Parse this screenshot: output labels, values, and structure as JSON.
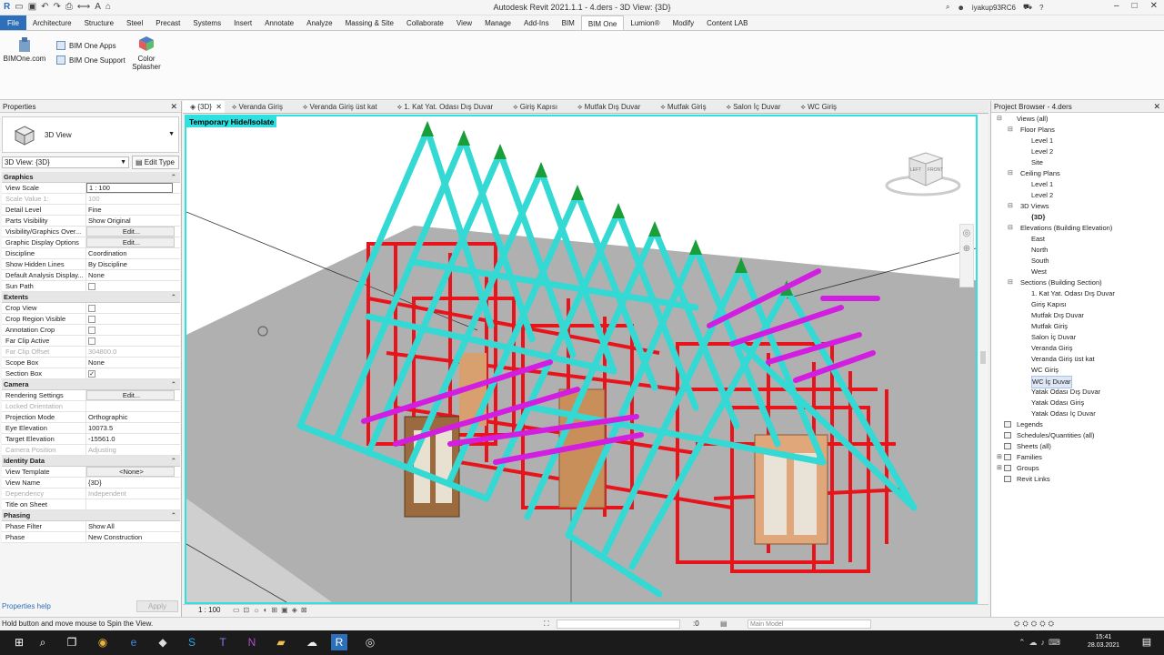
{
  "titlebar": {
    "title": "Autodesk Revit 2021.1.1 - 4.ders - 3D View: {3D}",
    "user": "iyakup93RC6"
  },
  "menu": {
    "tabs": [
      "File",
      "Architecture",
      "Structure",
      "Steel",
      "Precast",
      "Systems",
      "Insert",
      "Annotate",
      "Analyze",
      "Massing & Site",
      "Collaborate",
      "View",
      "Manage",
      "Add-Ins",
      "BIM",
      "BIM One",
      "Lumion®",
      "Modify",
      "Content LAB"
    ]
  },
  "ribbon": {
    "bimone_com": "BIMOne.com",
    "bimone_apps": "BIM One Apps",
    "bimone_support": "BIM One Support",
    "color_splasher": "Color Splasher"
  },
  "properties": {
    "title": "Properties",
    "type_name": "3D View",
    "view_selector": "3D View: {3D}",
    "edit_type": "Edit Type",
    "groups": [
      {
        "name": "Graphics",
        "rows": [
          {
            "k": "View Scale",
            "v": "1 : 100",
            "kind": "input"
          },
          {
            "k": "Scale Value    1:",
            "v": "100",
            "kind": "dim"
          },
          {
            "k": "Detail Level",
            "v": "Fine"
          },
          {
            "k": "Parts Visibility",
            "v": "Show Original"
          },
          {
            "k": "Visibility/Graphics Over...",
            "v": "Edit...",
            "kind": "btn"
          },
          {
            "k": "Graphic Display Options",
            "v": "Edit...",
            "kind": "btn"
          },
          {
            "k": "Discipline",
            "v": "Coordination"
          },
          {
            "k": "Show Hidden Lines",
            "v": "By Discipline"
          },
          {
            "k": "Default Analysis Display...",
            "v": "None"
          },
          {
            "k": "Sun Path",
            "v": "",
            "kind": "cb"
          }
        ]
      },
      {
        "name": "Extents",
        "rows": [
          {
            "k": "Crop View",
            "v": "",
            "kind": "cb"
          },
          {
            "k": "Crop Region Visible",
            "v": "",
            "kind": "cb"
          },
          {
            "k": "Annotation Crop",
            "v": "",
            "kind": "cb"
          },
          {
            "k": "Far Clip Active",
            "v": "",
            "kind": "cb"
          },
          {
            "k": "Far Clip Offset",
            "v": "304800.0",
            "kind": "dim"
          },
          {
            "k": "Scope Box",
            "v": "None"
          },
          {
            "k": "Section Box",
            "v": "✓",
            "kind": "cb"
          }
        ]
      },
      {
        "name": "Camera",
        "rows": [
          {
            "k": "Rendering Settings",
            "v": "Edit...",
            "kind": "btn"
          },
          {
            "k": "Locked Orientation",
            "v": "",
            "kind": "dim"
          },
          {
            "k": "Projection Mode",
            "v": "Orthographic"
          },
          {
            "k": "Eye Elevation",
            "v": "10073.5"
          },
          {
            "k": "Target Elevation",
            "v": "-15561.0"
          },
          {
            "k": "Camera Position",
            "v": "Adjusting",
            "kind": "dim"
          }
        ]
      },
      {
        "name": "Identity Data",
        "rows": [
          {
            "k": "View Template",
            "v": "<None>",
            "kind": "btn"
          },
          {
            "k": "View Name",
            "v": "{3D}"
          },
          {
            "k": "Dependency",
            "v": "Independent",
            "kind": "dim"
          },
          {
            "k": "Title on Sheet",
            "v": ""
          }
        ]
      },
      {
        "name": "Phasing",
        "rows": [
          {
            "k": "Phase Filter",
            "v": "Show All"
          },
          {
            "k": "Phase",
            "v": "New Construction"
          }
        ]
      }
    ],
    "help": "Properties help",
    "apply": "Apply"
  },
  "viewtabs": [
    "{3D}",
    "Veranda Giriş",
    "Veranda Giriş üst kat",
    "1. Kat Yat. Odası Dış Duvar",
    "Giriş Kapısı",
    "Mutfak Dış Duvar",
    "Mutfak Giriş",
    "Salon İç Duvar",
    "WC Giriş"
  ],
  "viewport": {
    "banner": "Temporary Hide/Isolate",
    "cube_top": "LEFT",
    "cube_front": "FRONT"
  },
  "viewcontrol": {
    "scale": "1 : 100"
  },
  "browser": {
    "title": "Project Browser - 4.ders",
    "nodes": [
      {
        "t": "Views (all)",
        "lvl": 0,
        "tg": "⊟"
      },
      {
        "t": "Floor Plans",
        "lvl": 1,
        "tg": "⊟"
      },
      {
        "t": "Level 1",
        "lvl": 2
      },
      {
        "t": "Level 2",
        "lvl": 2
      },
      {
        "t": "Site",
        "lvl": 2
      },
      {
        "t": "Ceiling Plans",
        "lvl": 1,
        "tg": "⊟"
      },
      {
        "t": "Level 1",
        "lvl": 2
      },
      {
        "t": "Level 2",
        "lvl": 2
      },
      {
        "t": "3D Views",
        "lvl": 1,
        "tg": "⊟"
      },
      {
        "t": "{3D}",
        "lvl": 2,
        "bold": true
      },
      {
        "t": "Elevations (Building Elevation)",
        "lvl": 1,
        "tg": "⊟"
      },
      {
        "t": "East",
        "lvl": 2
      },
      {
        "t": "North",
        "lvl": 2
      },
      {
        "t": "South",
        "lvl": 2
      },
      {
        "t": "West",
        "lvl": 2
      },
      {
        "t": "Sections (Building Section)",
        "lvl": 1,
        "tg": "⊟"
      },
      {
        "t": "1. Kat Yat. Odası Dış Duvar",
        "lvl": 2
      },
      {
        "t": "Giriş Kapısı",
        "lvl": 2
      },
      {
        "t": "Mutfak Dış Duvar",
        "lvl": 2
      },
      {
        "t": "Mutfak Giriş",
        "lvl": 2
      },
      {
        "t": "Salon İç Duvar",
        "lvl": 2
      },
      {
        "t": "Veranda Giriş",
        "lvl": 2
      },
      {
        "t": "Veranda Giriş üst kat",
        "lvl": 2
      },
      {
        "t": "WC Giriş",
        "lvl": 2
      },
      {
        "t": "WC İç Duvar",
        "lvl": 2,
        "sel": true
      },
      {
        "t": "Yatak Odası Dış Duvar",
        "lvl": 2
      },
      {
        "t": "Yatak Odası Giriş",
        "lvl": 2
      },
      {
        "t": "Yatak Odası İç Duvar",
        "lvl": 2
      },
      {
        "t": "Legends",
        "lvl": 0,
        "ic": true
      },
      {
        "t": "Schedules/Quantities (all)",
        "lvl": 0,
        "ic": true
      },
      {
        "t": "Sheets (all)",
        "lvl": 0,
        "ic": true
      },
      {
        "t": "Families",
        "lvl": 0,
        "tg": "⊞",
        "ic": true
      },
      {
        "t": "Groups",
        "lvl": 0,
        "tg": "⊞",
        "ic": true
      },
      {
        "t": "Revit Links",
        "lvl": 0,
        "ic": true
      }
    ]
  },
  "status": {
    "message": "Hold button and move mouse to Spin the View.",
    "count": ":0",
    "model": "Main Model"
  },
  "clock": {
    "time": "15:41",
    "date": "28.03.2021"
  },
  "colors": {
    "highlight": "#2ee0e0",
    "truss": "#35d9d4",
    "frame": "#e8141c",
    "purlin": "#d21ee0"
  }
}
